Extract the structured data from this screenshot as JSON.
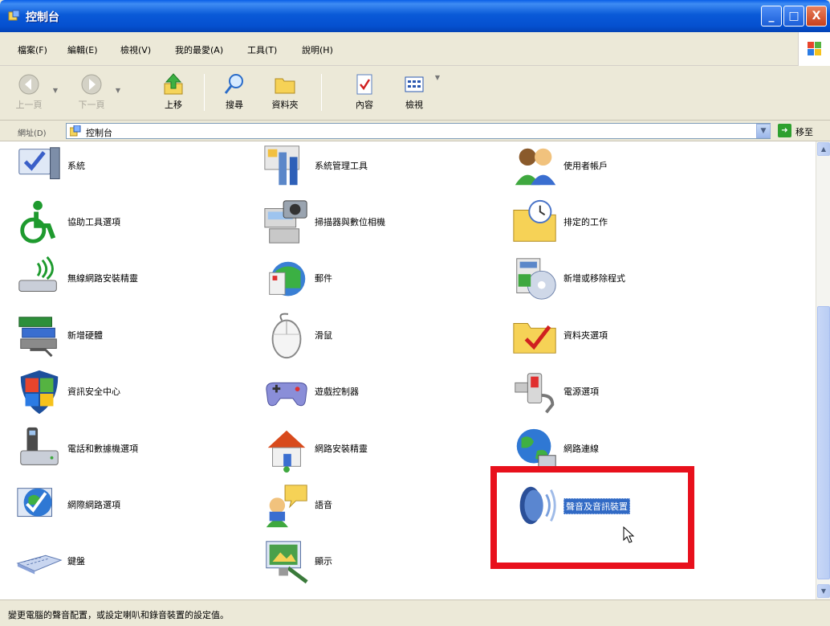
{
  "window": {
    "title": "控制台",
    "buttons": {
      "minimize": "_",
      "maximize": "□",
      "close": "X"
    }
  },
  "menu": {
    "items": [
      "檔案(F)",
      "編輯(E)",
      "檢視(V)",
      "我的最愛(A)",
      "工具(T)",
      "說明(H)"
    ]
  },
  "toolbar": {
    "back": "上一頁",
    "forward": "下一頁",
    "up": "上移",
    "search": "搜尋",
    "folders": "資料夾",
    "content": "內容",
    "view": "檢視"
  },
  "address": {
    "label": "網址(D)",
    "value": "控制台",
    "go": "移至"
  },
  "items": [
    {
      "label": "系統",
      "icon": "system-icon"
    },
    {
      "label": "系統管理工具",
      "icon": "admin-tools-icon"
    },
    {
      "label": "使用者帳戶",
      "icon": "user-accounts-icon"
    },
    {
      "label": "協助工具選項",
      "icon": "accessibility-icon"
    },
    {
      "label": "掃描器與數位相機",
      "icon": "scanner-camera-icon"
    },
    {
      "label": "排定的工作",
      "icon": "scheduled-tasks-icon"
    },
    {
      "label": "無線網路安裝精靈",
      "icon": "wireless-setup-icon"
    },
    {
      "label": "郵件",
      "icon": "mail-icon"
    },
    {
      "label": "新增或移除程式",
      "icon": "add-remove-programs-icon"
    },
    {
      "label": "新增硬體",
      "icon": "add-hardware-icon"
    },
    {
      "label": "滑鼠",
      "icon": "mouse-icon"
    },
    {
      "label": "資料夾選項",
      "icon": "folder-options-icon"
    },
    {
      "label": "資訊安全中心",
      "icon": "security-center-icon"
    },
    {
      "label": "遊戲控制器",
      "icon": "game-controller-icon"
    },
    {
      "label": "電源選項",
      "icon": "power-options-icon"
    },
    {
      "label": "電話和數據機選項",
      "icon": "phone-modem-icon"
    },
    {
      "label": "網路安裝精靈",
      "icon": "network-setup-icon"
    },
    {
      "label": "網路連線",
      "icon": "network-connections-icon"
    },
    {
      "label": "網際網路選項",
      "icon": "internet-options-icon"
    },
    {
      "label": "語音",
      "icon": "speech-icon"
    },
    {
      "label": "聲音及音訊裝置",
      "icon": "sound-audio-icon",
      "selected": true
    },
    {
      "label": "鍵盤",
      "icon": "keyboard-icon"
    },
    {
      "label": "顯示",
      "icon": "display-icon"
    }
  ],
  "status": {
    "text": "變更電腦的聲音配置，或設定喇叭和錄音裝置的設定值。"
  },
  "colors": {
    "titlebar": "#0a5ad8",
    "selection": "#316ac5",
    "highlight_box": "#e8101c"
  }
}
